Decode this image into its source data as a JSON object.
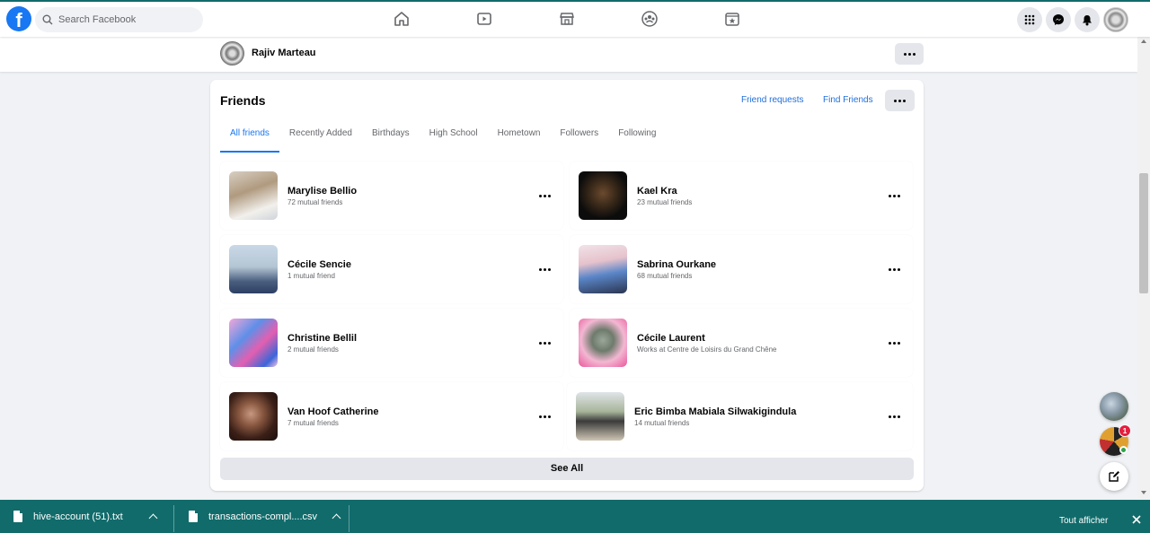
{
  "app": {
    "name": "Facebook"
  },
  "search": {
    "placeholder": "Search Facebook"
  },
  "nav": [
    {
      "icon": "home-icon"
    },
    {
      "icon": "watch-icon"
    },
    {
      "icon": "marketplace-icon"
    },
    {
      "icon": "groups-icon"
    },
    {
      "icon": "gaming-icon"
    }
  ],
  "header_right": [
    "menu-grid-icon",
    "messenger-icon",
    "notifications-icon",
    "account-avatar"
  ],
  "profile": {
    "name": "Rajiv Marteau"
  },
  "friends_section": {
    "title": "Friends",
    "friend_requests": "Friend requests",
    "find_friends": "Find Friends",
    "tabs": [
      "All friends",
      "Recently Added",
      "Birthdays",
      "High School",
      "Hometown",
      "Followers",
      "Following"
    ],
    "active_tab": "All friends",
    "friends": [
      {
        "name": "Marylise Bellio",
        "subtitle": "72 mutual friends"
      },
      {
        "name": "Kael Kra",
        "subtitle": "23 mutual friends"
      },
      {
        "name": "Cécile Sencie",
        "subtitle": "1 mutual friend"
      },
      {
        "name": "Sabrina Ourkane",
        "subtitle": "68 mutual friends"
      },
      {
        "name": "Christine Bellil",
        "subtitle": "2 mutual friends"
      },
      {
        "name": "Cécile Laurent",
        "subtitle": "Works at Centre de Loisirs du Grand Chêne"
      },
      {
        "name": "Van Hoof Catherine",
        "subtitle": "7 mutual friends"
      },
      {
        "name": "Eric Bimba Mabiala Silwakigindula",
        "subtitle": "14 mutual friends"
      }
    ],
    "see_all": "See All"
  },
  "chat": {
    "unread_badge": "1"
  },
  "downloads": {
    "files": [
      "hive-account (51).txt",
      "transactions-compl....csv"
    ],
    "show_all": "Tout afficher"
  },
  "colors": {
    "brand": "#1877f2",
    "link": "#216fdb",
    "download_bar": "#116b6b"
  }
}
